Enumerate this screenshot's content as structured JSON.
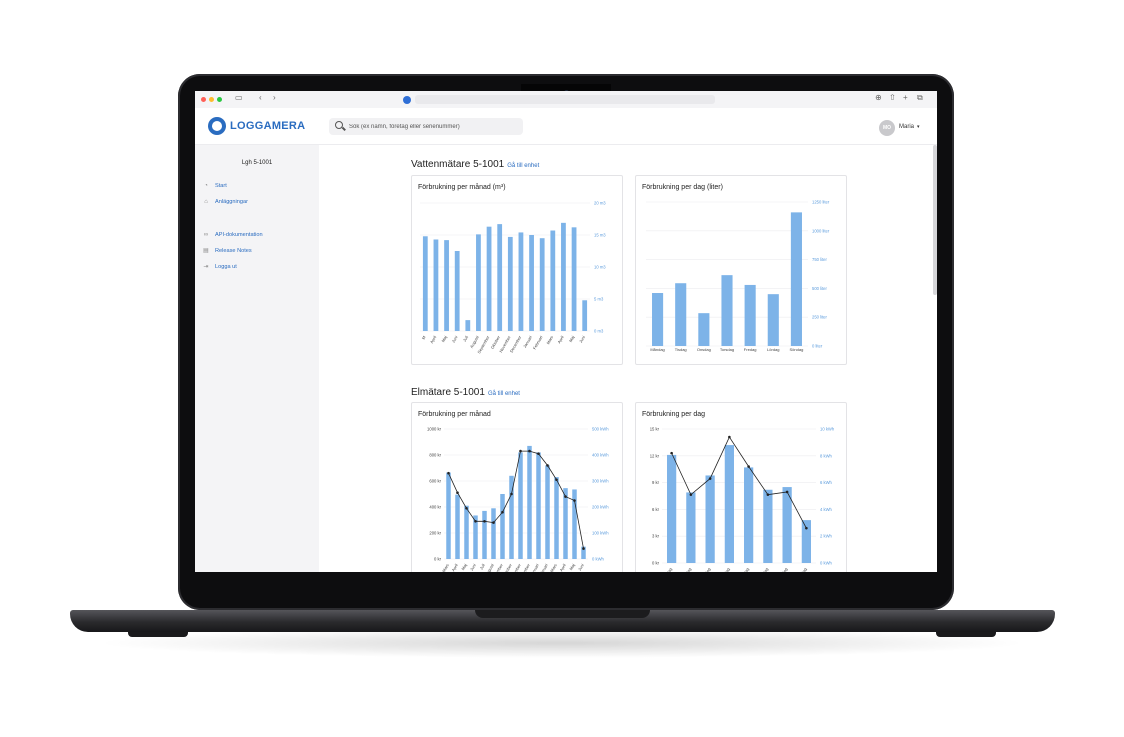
{
  "browser": {
    "tab_icons": [
      "sidebar-icon",
      "back-icon",
      "forward-icon",
      "shield-icon",
      "download-icon",
      "share-icon",
      "new-tab-icon",
      "tabs-icon"
    ]
  },
  "header": {
    "logo_text": "LOGGAMERA",
    "search_placeholder": "Sök (ex namn, företag eller serienummer)",
    "avatar_initials": "MO",
    "user_name": "Maria"
  },
  "sidebar": {
    "title": "Lgh 5-1001",
    "items": [
      {
        "label": "Start",
        "icon": "home-icon"
      },
      {
        "label": "Anläggningar",
        "icon": "building-icon"
      },
      {
        "label": "API-dokumentation",
        "icon": "link-icon"
      },
      {
        "label": "Release Notes",
        "icon": "document-icon"
      },
      {
        "label": "Logga ut",
        "icon": "logout-icon"
      }
    ]
  },
  "sections": [
    {
      "title": "Vattenmätare 5-1001",
      "link": "Gå till enhet"
    },
    {
      "title": "Elmätare 5-1001",
      "link": "Gå till enhet"
    }
  ],
  "chart_data": [
    {
      "type": "bar",
      "title": "Förbrukning per månad (m³)",
      "categories": [
        "M",
        "April",
        "Maj",
        "Juni",
        "Juli",
        "Augusti",
        "September",
        "Oktober",
        "November",
        "December",
        "Januari",
        "Februari",
        "Mars",
        "April",
        "Maj",
        "Juni"
      ],
      "values": [
        14.8,
        14.3,
        14.2,
        12.5,
        1.7,
        15.1,
        16.3,
        16.7,
        14.7,
        15.4,
        15.0,
        14.5,
        15.7,
        16.9,
        16.2,
        4.8
      ],
      "y_ticks": [
        "20 m3",
        "15 m3",
        "10 m3",
        "5 m3",
        "0 m3"
      ],
      "ylim": [
        0,
        20
      ],
      "y_axis_side": "right"
    },
    {
      "type": "bar",
      "title": "Förbrukning per dag (liter)",
      "categories": [
        "Måndag",
        "Tisdag",
        "Onsdag",
        "Torsdag",
        "Fredag",
        "Lördag",
        "Söndag"
      ],
      "values": [
        460,
        545,
        285,
        615,
        530,
        450,
        1160
      ],
      "y_ticks": [
        "1250 liter",
        "1000 liter",
        "750 liter",
        "500 liter",
        "250 liter",
        "0 liter"
      ],
      "ylim": [
        0,
        1250
      ],
      "y_axis_side": "right"
    },
    {
      "type": "bar",
      "title": "Förbrukning per månad",
      "categories": [
        "Mars",
        "April",
        "Maj",
        "Juni",
        "Juli",
        "Augusti",
        "September",
        "Oktober",
        "November",
        "December",
        "Januari",
        "Februari",
        "Mars",
        "April",
        "Maj",
        "Juni"
      ],
      "series": [
        {
          "values": [
            665,
            495,
            410,
            335,
            370,
            390,
            500,
            640,
            820,
            870,
            820,
            720,
            630,
            545,
            535,
            95
          ]
        },
        {
          "values": [
            330,
            255,
            195,
            145,
            145,
            140,
            180,
            250,
            415,
            415,
            405,
            360,
            305,
            240,
            225,
            40
          ]
        }
      ],
      "y_ticks_left": [
        "1000 kr",
        "800 kr",
        "600 kr",
        "400 kr",
        "200 kr",
        "0 kr"
      ],
      "y_ticks_right": [
        "500 kWh",
        "400 kWh",
        "300 kWh",
        "200 kWh",
        "100 kWh",
        "0 kWh"
      ],
      "ylim_left": [
        0,
        1000
      ],
      "ylim_right": [
        0,
        500
      ]
    },
    {
      "type": "bar",
      "title": "Förbrukning per dag",
      "categories": [
        "dag",
        "dag",
        "dag",
        "dag",
        "dag",
        "dag",
        "dag",
        "dag"
      ],
      "series": [
        {
          "values": [
            12.1,
            7.9,
            9.8,
            13.2,
            10.7,
            8.2,
            8.5,
            4.8
          ]
        },
        {
          "values": [
            8.2,
            5.1,
            6.3,
            9.4,
            7.2,
            5.1,
            5.3,
            2.6
          ]
        }
      ],
      "y_ticks_left": [
        "15 kr",
        "12 kr",
        "9 kr",
        "6 kr",
        "3 kr",
        "0 kr"
      ],
      "y_ticks_right": [
        "10 kWh",
        "8 kWh",
        "6 kWh",
        "4 kWh",
        "2 kWh",
        "0 kWh"
      ],
      "ylim_left": [
        0,
        15
      ],
      "ylim_right": [
        0,
        10
      ]
    }
  ],
  "colors": {
    "bar": "#7db3e8",
    "line": "#222222",
    "accent": "#2a6cc0",
    "tick": "#5b9bdc"
  }
}
